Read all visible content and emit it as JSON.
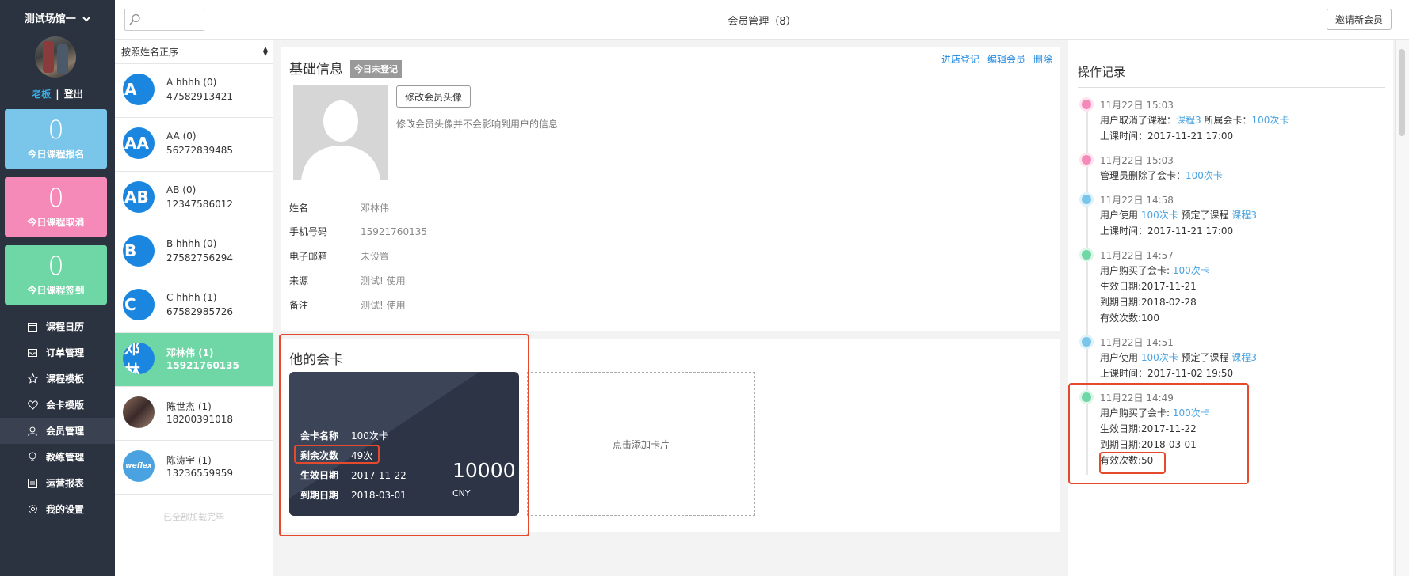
{
  "sidebar": {
    "venue": "测试场馆一",
    "user_role": "老板",
    "user_sep": "|",
    "logout": "登出",
    "stats": [
      {
        "value": "0",
        "label": "今日课程报名",
        "color": "#79c6ea"
      },
      {
        "value": "0",
        "label": "今日课程取消",
        "color": "#f589b8"
      },
      {
        "value": "0",
        "label": "今日课程签到",
        "color": "#6fd6a6"
      }
    ],
    "nav": [
      {
        "label": "课程日历",
        "icon": "calendar-icon"
      },
      {
        "label": "订单管理",
        "icon": "inbox-icon"
      },
      {
        "label": "课程模板",
        "icon": "star-icon"
      },
      {
        "label": "会卡模版",
        "icon": "heart-icon"
      },
      {
        "label": "会员管理",
        "icon": "user-icon"
      },
      {
        "label": "教练管理",
        "icon": "bulb-icon"
      },
      {
        "label": "运营报表",
        "icon": "report-icon"
      },
      {
        "label": "我的设置",
        "icon": "gear-icon"
      }
    ]
  },
  "topbar": {
    "search_placeholder": "",
    "title": "会员管理（8）",
    "invite_label": "邀请新会员"
  },
  "memberlist": {
    "sort_label": "按照姓名正序",
    "members": [
      {
        "initials": "A",
        "name": "A hhhh (0)",
        "phone": "47582913421"
      },
      {
        "initials": "AA",
        "name": "AA (0)",
        "phone": "56272839485"
      },
      {
        "initials": "AB",
        "name": "AB (0)",
        "phone": "12347586012"
      },
      {
        "initials": "B",
        "name": "B hhhh (0)",
        "phone": "27582756294"
      },
      {
        "initials": "C",
        "name": "C hhhh (1)",
        "phone": "67582985726"
      },
      {
        "initials": "邓林",
        "name": "邓林伟 (1)",
        "phone": "15921760135"
      },
      {
        "initials": "",
        "name": "陈世杰 (1)",
        "phone": "18200391018"
      },
      {
        "initials": "weflex",
        "name": "陈涛宇 (1)",
        "phone": "13236559959"
      }
    ],
    "loaded_all": "已全部加载完毕"
  },
  "basic": {
    "title": "基础信息",
    "badge": "今日未登记",
    "actions": [
      "进店登记",
      "编辑会员",
      "删除"
    ],
    "edit_avatar": "修改会员头像",
    "avatar_hint": "修改会员头像并不会影响到用户的信息",
    "fields": [
      {
        "k": "姓名",
        "v": "邓林伟"
      },
      {
        "k": "手机号码",
        "v": "15921760135"
      },
      {
        "k": "电子邮箱",
        "v": "未设置"
      },
      {
        "k": "来源",
        "v": "测试! 使用"
      },
      {
        "k": "备注",
        "v": "测试! 使用"
      }
    ]
  },
  "cards": {
    "title": "他的会卡",
    "card": {
      "name_k": "会卡名称",
      "name_v": "100次卡",
      "remain_k": "剩余次数",
      "remain_v": "49次",
      "start_k": "生效日期",
      "start_v": "2017-11-22",
      "end_k": "到期日期",
      "end_v": "2018-03-01",
      "amount": "10000",
      "currency": "CNY"
    },
    "add_label": "点击添加卡片"
  },
  "oplog": {
    "title": "操作记录",
    "items": [
      {
        "time": "11月22日 15:03",
        "l1a": "用户取消了课程：",
        "l1b": "课程3",
        "l1c": " 所属会卡：",
        "l1d": "100次卡",
        "l2": "上课时间：2017-11-21 17:00"
      },
      {
        "time": "11月22日 15:03",
        "l1a": "管理员删除了会卡：",
        "l1b": "100次卡"
      },
      {
        "time": "11月22日 14:58",
        "l1a": "用户使用 ",
        "l1b": "100次卡",
        "l1c": " 预定了课程 ",
        "l1d": "课程3",
        "l2": "上课时间：2017-11-21 17:00"
      },
      {
        "time": "11月22日 14:57",
        "l1a": "用户购买了会卡: ",
        "l1b": "100次卡",
        "l2": "生效日期:2017-11-21",
        "l3": "到期日期:2018-02-28",
        "l4": "有效次数:100"
      },
      {
        "time": "11月22日 14:51",
        "l1a": "用户使用 ",
        "l1b": "100次卡",
        "l1c": " 预定了课程 ",
        "l1d": "课程3",
        "l2": "上课时间：2017-11-02 19:50"
      },
      {
        "time": "11月22日 14:49",
        "l1a": "用户购买了会卡: ",
        "l1b": "100次卡",
        "l2": "生效日期:2017-11-22",
        "l3": "到期日期:2018-03-01",
        "l4": "有效次数:50"
      }
    ]
  }
}
